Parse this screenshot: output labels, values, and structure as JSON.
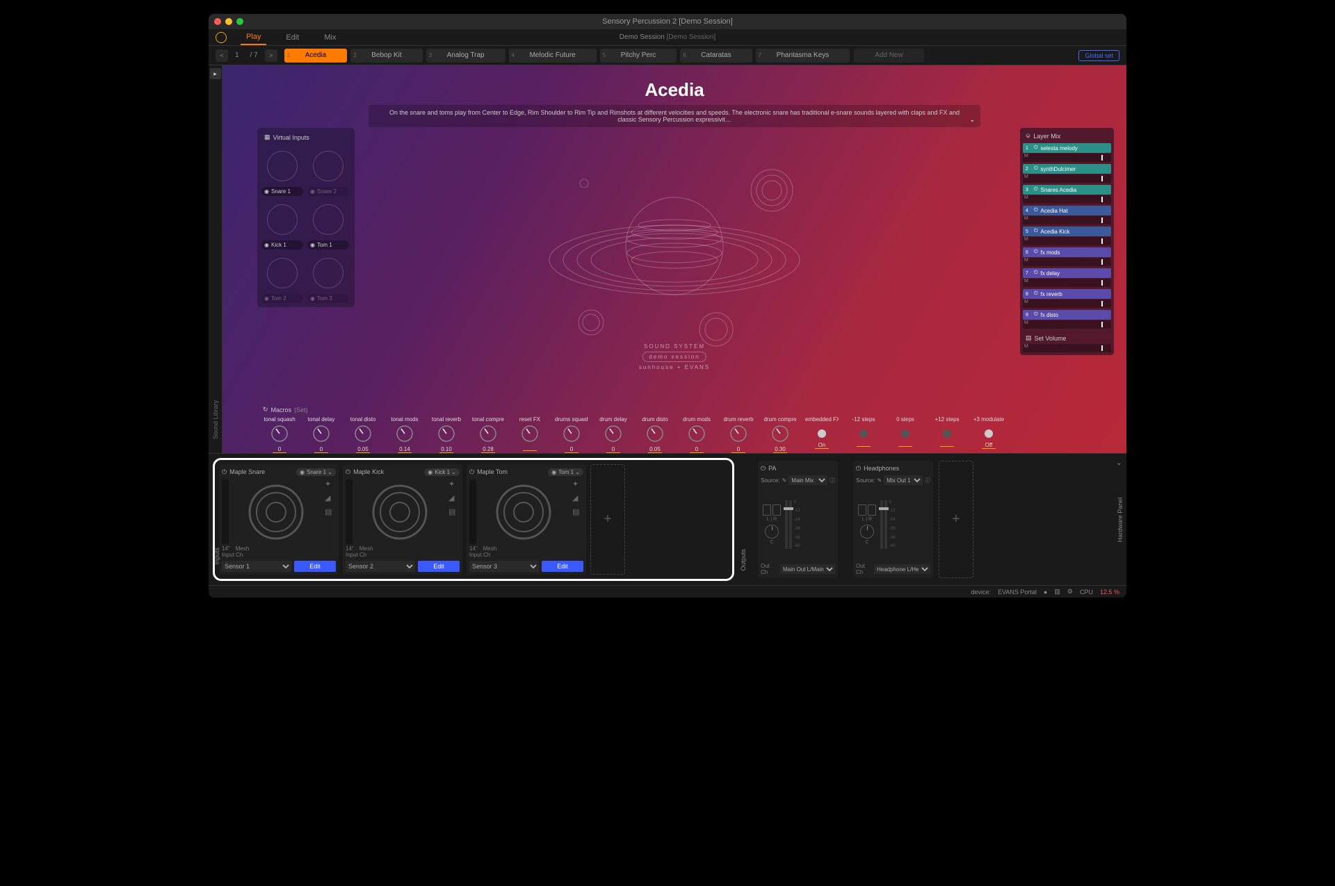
{
  "app_title": "Sensory Percussion 2 [Demo Session]",
  "session": {
    "name": "Demo Session",
    "tag": "[Demo Session]"
  },
  "tabs": {
    "play": "Play",
    "edit": "Edit",
    "mix": "Mix"
  },
  "pager": {
    "prev": "<",
    "next": ">",
    "current": "1",
    "total": "/ 7"
  },
  "sets": [
    {
      "num": "1",
      "name": "Acedia",
      "active": true
    },
    {
      "num": "2",
      "name": "Bebop Kit"
    },
    {
      "num": "3",
      "name": "Analog Trap"
    },
    {
      "num": "4",
      "name": "Melodic Future"
    },
    {
      "num": "5",
      "name": "Pitchy Perc"
    },
    {
      "num": "6",
      "name": "Cataratas"
    },
    {
      "num": "7",
      "name": "Phantasma Keys"
    }
  ],
  "add_new": "Add New",
  "global_set": "Global set",
  "sidebar": {
    "sound_library": "Sound Library"
  },
  "preset": {
    "title": "Acedia",
    "desc": "On the snare and toms play from Center to Edge, Rim Shoulder to Rim Tip and Rimshots at different velocities and speeds. The electronic snare has traditional e-snare sounds layered with claps and FX and classic Sensory Percussion expressivit…"
  },
  "virtual_inputs": {
    "header": "Virtual Inputs",
    "rows": [
      [
        {
          "label": "Snare 1",
          "dim": false
        },
        {
          "label": "Snare 2",
          "dim": true
        }
      ],
      [
        {
          "label": "Kick 1",
          "dim": false
        },
        {
          "label": "Tom 1",
          "dim": false
        }
      ],
      [
        {
          "label": "Tom 2",
          "dim": true
        },
        {
          "label": "Tom 3",
          "dim": true
        }
      ]
    ]
  },
  "layer_mix": {
    "header": "Layer Mix",
    "items": [
      {
        "idx": "1",
        "name": "selesta melody",
        "color": "c-teal"
      },
      {
        "idx": "2",
        "name": "synthDulcimer",
        "color": "c-teal"
      },
      {
        "idx": "3",
        "name": "Snares Acedia",
        "color": "c-teal"
      },
      {
        "idx": "4",
        "name": "Acedia Hat",
        "color": "c-blue"
      },
      {
        "idx": "5",
        "name": "Acedia Kick",
        "color": "c-blue"
      },
      {
        "idx": "6",
        "name": "fx  mods",
        "color": "c-purple"
      },
      {
        "idx": "7",
        "name": "fx  delay",
        "color": "c-purple"
      },
      {
        "idx": "8",
        "name": "fx  reverb",
        "color": "c-purple"
      },
      {
        "idx": "9",
        "name": "fx  disto",
        "color": "c-purple"
      }
    ],
    "set_volume": "Set Volume"
  },
  "sound_system": {
    "line1": "SOUND SYSTEM",
    "line2": "demo session",
    "line3": "sunhouse + EVANS"
  },
  "macros": {
    "header": "Macros",
    "set": "(Set)",
    "knobs": [
      {
        "label": "tonal squash",
        "val": "0"
      },
      {
        "label": "tonal delay",
        "val": "0"
      },
      {
        "label": "tonal disto",
        "val": "0.05"
      },
      {
        "label": "tonal mods",
        "val": "0.14"
      },
      {
        "label": "tonal reverb",
        "val": "0.10"
      },
      {
        "label": "tonal compre",
        "val": "0.28"
      },
      {
        "label": "reset FX",
        "val": ""
      },
      {
        "label": "drums squash",
        "val": "0"
      },
      {
        "label": "drum delay",
        "val": "0"
      },
      {
        "label": "drum disto",
        "val": "0.05"
      },
      {
        "label": "drum mods",
        "val": "0"
      },
      {
        "label": "drum reverb",
        "val": "0"
      },
      {
        "label": "drum compre",
        "val": "0.30"
      }
    ],
    "toggles": [
      {
        "label": "embedded FX",
        "val": "On",
        "on": true
      },
      {
        "label": "-12 steps",
        "val": "",
        "on": false
      },
      {
        "label": "0 steps",
        "val": "",
        "on": false
      },
      {
        "label": "+12 steps",
        "val": "",
        "on": false
      },
      {
        "label": "+3 modulate",
        "val": "Off",
        "on": true
      }
    ]
  },
  "inputs_panel": {
    "label": "Inputs",
    "modules": [
      {
        "name": "Maple Snare",
        "assign": "Snare",
        "assign_n": "1",
        "size": "14\"",
        "mat": "Mesh",
        "ch_label": "Input Ch",
        "sensor": "Sensor 1",
        "edit": "Edit"
      },
      {
        "name": "Maple Kick",
        "assign": "Kick",
        "assign_n": "1",
        "size": "14\"",
        "mat": "Mesh",
        "ch_label": "Input Ch",
        "sensor": "Sensor 2",
        "edit": "Edit"
      },
      {
        "name": "Maple Tom",
        "assign": "Tom",
        "assign_n": "1",
        "size": "14\"",
        "mat": "Mesh",
        "ch_label": "Input Ch",
        "sensor": "Sensor 3",
        "edit": "Edit"
      }
    ]
  },
  "outputs_panel": {
    "label": "Outputs",
    "modules": [
      {
        "name": "PA",
        "source_label": "Source:",
        "source": "Main Mix",
        "lr": "L | R",
        "c": "C",
        "out_label": "Out Ch",
        "out": "Main Out L/Main"
      },
      {
        "name": "Headphones",
        "source_label": "Source:",
        "source": "Mix Out 1",
        "lr": "L | R",
        "c": "C",
        "out_label": "Out Ch",
        "out": "Headphone L/He"
      }
    ],
    "scale": [
      "0",
      "-12",
      "-24",
      "-36",
      "-48",
      "-60"
    ],
    "hw_panel": "Hardware Panel"
  },
  "statusbar": {
    "device_label": "device:",
    "device": "EVANS Portal",
    "cpu_label": "CPU",
    "cpu_val": "12.5 %"
  }
}
